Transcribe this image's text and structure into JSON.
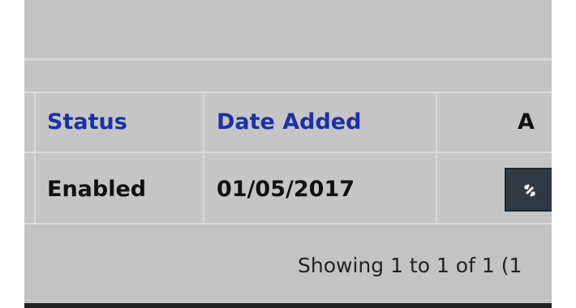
{
  "table": {
    "headers": {
      "status": "Status",
      "date_added": "Date Added",
      "action": "A"
    },
    "rows": [
      {
        "status": "Enabled",
        "date_added": "01/05/2017"
      }
    ]
  },
  "pagination": {
    "summary": "Showing 1 to 1 of 1 (1"
  },
  "icons": {
    "action_button": "link-icon"
  },
  "colors": {
    "header_link": "#1b31a8",
    "action_button": "#2e3a44"
  }
}
